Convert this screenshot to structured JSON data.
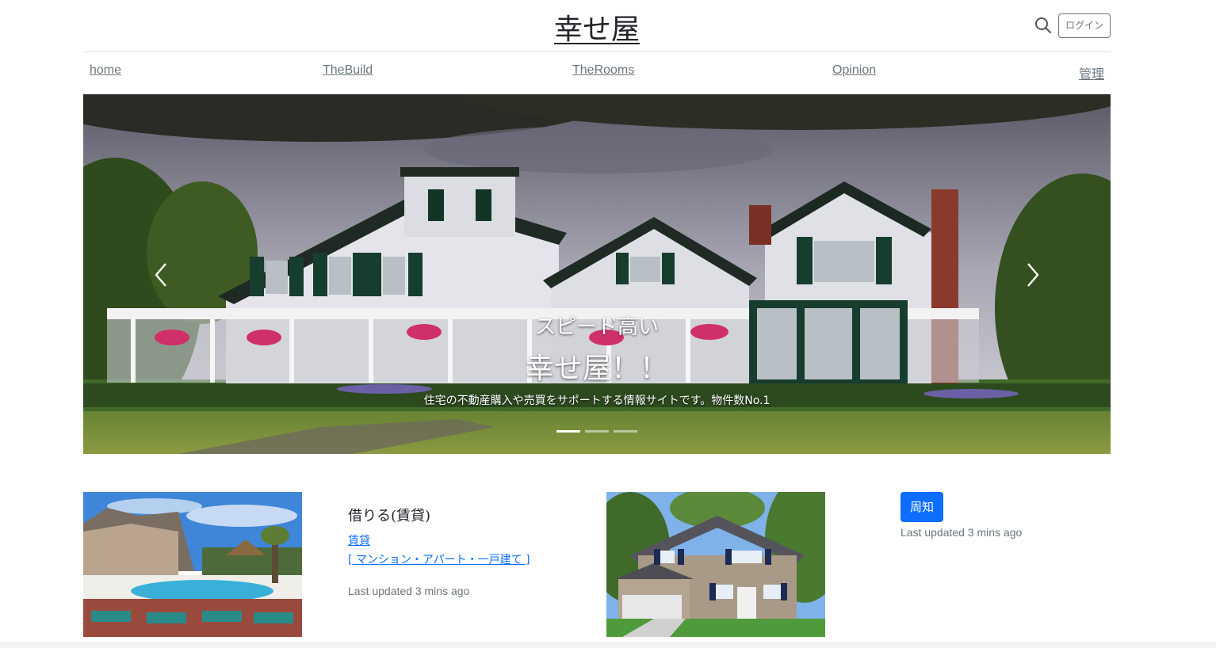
{
  "header": {
    "brand": "幸せ屋",
    "login_label": "ログイン",
    "search_icon": "search-icon"
  },
  "nav": {
    "items": [
      {
        "label": "home"
      },
      {
        "label": "TheBuild"
      },
      {
        "label": "TheRooms"
      },
      {
        "label": "Opinion"
      },
      {
        "label": "管理"
      }
    ]
  },
  "carousel": {
    "subtitle": "スピード高い",
    "title": "幸せ屋！！",
    "text": "住宅の不動産購入や売買をサポートする情報サイトです。物件数No.1",
    "slide_count": 3,
    "active_slide": 1,
    "prev_icon": "chevron-left-icon",
    "next_icon": "chevron-right-icon"
  },
  "cards": {
    "rent": {
      "title": "借りる(賃貸)",
      "link1": "賃貸",
      "link2": "[ マンション・アパート・一戸建て ]",
      "updated": "Last updated 3 mins ago"
    },
    "notice": {
      "button_label": "周知",
      "updated": "Last updated 3 mins ago"
    }
  },
  "colors": {
    "primary": "#0d6efd",
    "muted": "#6c757d",
    "border": "#dee2e6"
  }
}
